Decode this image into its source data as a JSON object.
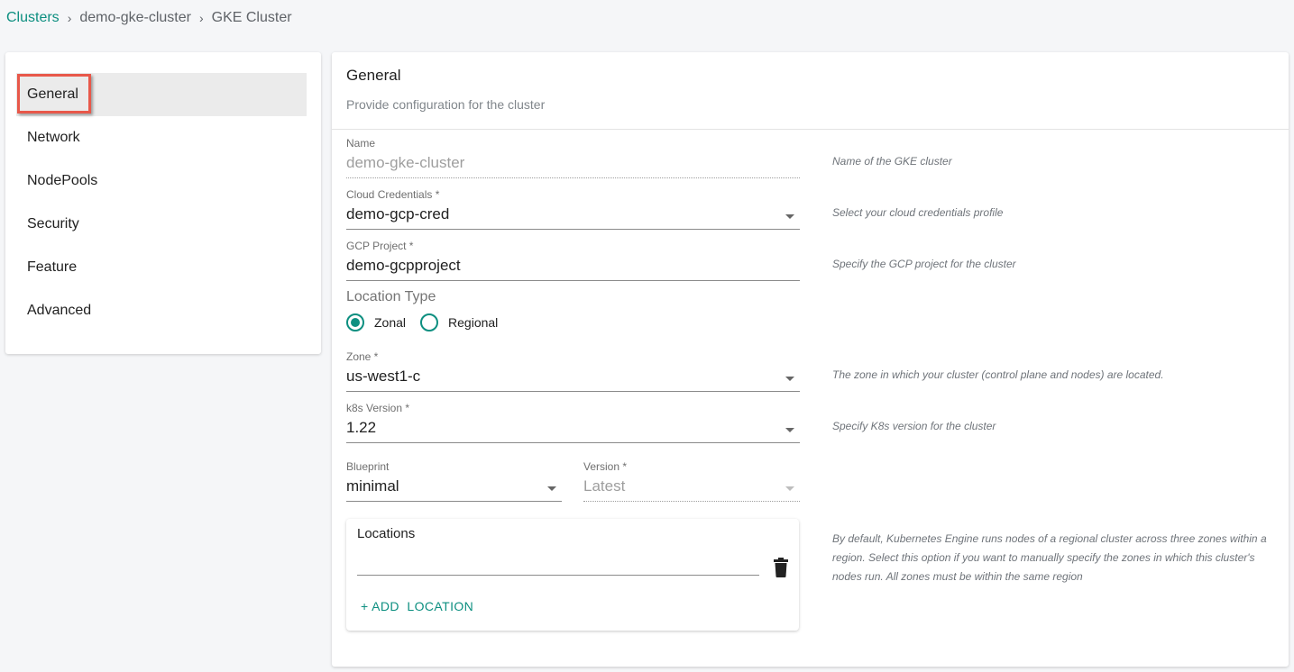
{
  "breadcrumb": {
    "items": [
      "Clusters",
      "demo-gke-cluster",
      "GKE Cluster"
    ],
    "separator": "›"
  },
  "sidebar": {
    "items": [
      {
        "label": "General",
        "active": true
      },
      {
        "label": "Network"
      },
      {
        "label": "NodePools"
      },
      {
        "label": "Security"
      },
      {
        "label": "Feature"
      },
      {
        "label": "Advanced"
      }
    ]
  },
  "main": {
    "title": "General",
    "subtitle": "Provide configuration for the cluster",
    "fields": {
      "name": {
        "label": "Name",
        "value": "demo-gke-cluster",
        "help": "Name of the GKE cluster"
      },
      "cloud_credentials": {
        "label": "Cloud Credentials *",
        "value": "demo-gcp-cred",
        "help": "Select your cloud credentials profile"
      },
      "gcp_project": {
        "label": "GCP Project *",
        "value": "demo-gcpproject",
        "help": "Specify the GCP project for the cluster"
      },
      "location_type": {
        "label": "Location Type",
        "options": [
          "Zonal",
          "Regional"
        ],
        "selected": "Zonal"
      },
      "zone": {
        "label": "Zone *",
        "value": "us-west1-c",
        "help": "The zone in which your cluster (control plane and nodes) are located."
      },
      "k8s_version": {
        "label": "k8s Version *",
        "value": "1.22",
        "help": "Specify K8s version for the cluster"
      },
      "blueprint": {
        "label": "Blueprint",
        "value": "minimal"
      },
      "blueprint_version": {
        "label": "Version *",
        "value": "Latest"
      }
    },
    "locations": {
      "title": "Locations",
      "input_value": "",
      "add_button": "+ ADD  LOCATION",
      "help": "By default, Kubernetes Engine runs nodes of a regional cluster across three zones within a region. Select this option if you want to manually specify the zones in which this cluster's nodes run. All zones must be within the same region"
    }
  },
  "colors": {
    "accent": "#0d8f80",
    "highlight_border": "#e8584a"
  }
}
